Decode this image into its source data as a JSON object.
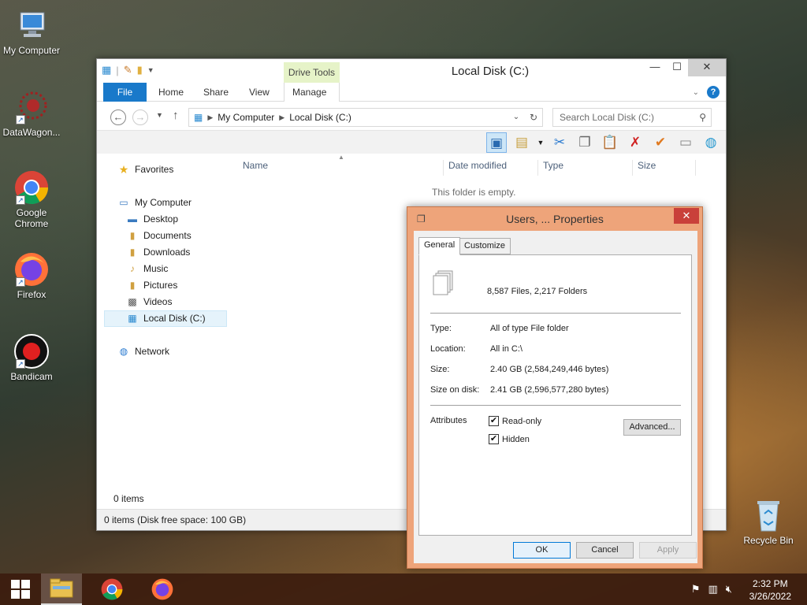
{
  "desktop": {
    "icons": [
      {
        "label": "My Computer"
      },
      {
        "label": "DataWagon..."
      },
      {
        "label": "Google Chrome"
      },
      {
        "label": "Firefox"
      },
      {
        "label": "Bandicam"
      },
      {
        "label": "Recycle Bin"
      }
    ]
  },
  "explorer": {
    "title": "Local Disk (C:)",
    "drive_tools": "Drive Tools",
    "tabs": {
      "file": "File",
      "home": "Home",
      "share": "Share",
      "view": "View",
      "manage": "Manage"
    },
    "address": {
      "part1": "My Computer",
      "part2": "Local Disk (C:)"
    },
    "search_placeholder": "Search Local Disk (C:)",
    "nav": {
      "favorites": "Favorites",
      "my_computer": "My Computer",
      "desktop": "Desktop",
      "documents": "Documents",
      "downloads": "Downloads",
      "music": "Music",
      "pictures": "Pictures",
      "videos": "Videos",
      "local_disk": "Local Disk (C:)",
      "network": "Network"
    },
    "columns": {
      "name": "Name",
      "date": "Date modified",
      "type": "Type",
      "size": "Size"
    },
    "empty_message": "This folder is empty.",
    "item_count": "0 items",
    "status": "0 items (Disk free space: 100 GB)"
  },
  "properties": {
    "title": "Users, ... Properties",
    "tabs": {
      "general": "General",
      "customize": "Customize"
    },
    "summary": "8,587 Files, 2,217 Folders",
    "type_label": "Type:",
    "type_value": "All of type File folder",
    "location_label": "Location:",
    "location_value": "All in C:\\",
    "size_label": "Size:",
    "size_value": "2.40 GB (2,584,249,446 bytes)",
    "size_on_disk_label": "Size on disk:",
    "size_on_disk_value": "2.41 GB (2,596,577,280 bytes)",
    "attributes_label": "Attributes",
    "readonly_label": "Read-only",
    "hidden_label": "Hidden",
    "advanced_label": "Advanced...",
    "ok_label": "OK",
    "cancel_label": "Cancel",
    "apply_label": "Apply"
  },
  "taskbar": {
    "time": "2:32 PM",
    "date": "3/26/2022"
  }
}
